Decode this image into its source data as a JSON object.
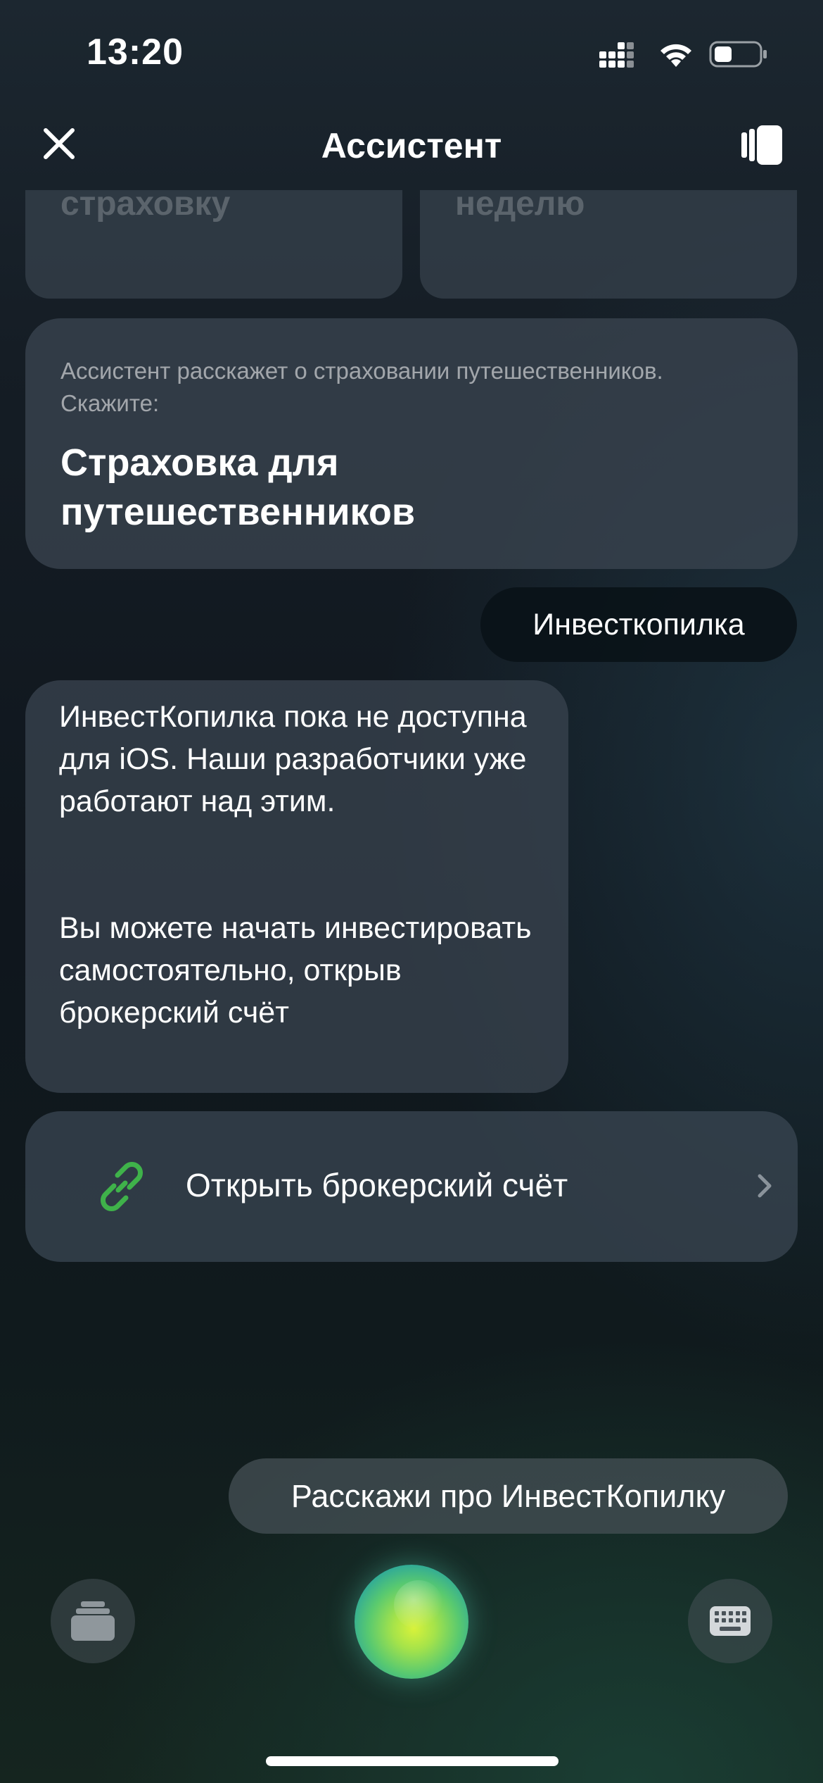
{
  "status_bar": {
    "time": "13:20"
  },
  "header": {
    "title": "Ассистент",
    "close_icon": "close-icon",
    "cards_icon": "cards-icon"
  },
  "top_cards": [
    {
      "text": "страховку"
    },
    {
      "text": "неделю"
    }
  ],
  "suggestion_card": {
    "hint": "Ассистент расскажет о страховании путешественников. Скажите:",
    "title": "Страховка для путешественников"
  },
  "user_message": {
    "text": "Инвесткопилка"
  },
  "assistant_message": {
    "paragraph1": "ИнвестКопилка пока не доступна для iOS. Наши разработчики уже работают над этим.",
    "paragraph2": "Вы можете начать инвестировать самостоятельно, открыв брокерский счёт"
  },
  "action": {
    "label": "Открыть брокерский счёт",
    "icon": "link-icon",
    "chevron": "chevron-right-icon",
    "icon_color": "#3fb24a"
  },
  "quick_suggestion": {
    "text": "Расскажи про ИнвестКопилку"
  },
  "bottom_bar": {
    "left_icon": "history-icon",
    "center": "assistant-orb",
    "right_icon": "keyboard-icon"
  }
}
